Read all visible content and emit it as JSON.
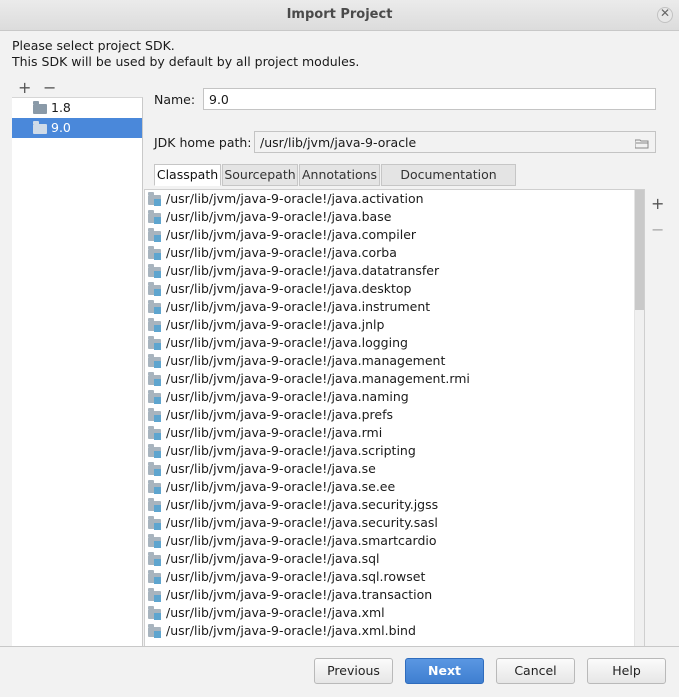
{
  "window": {
    "title": "Import Project",
    "close_glyph": "✕"
  },
  "intro": {
    "line1": "Please select project SDK.",
    "line2": "This SDK will be used by default by all project modules."
  },
  "sdk_toolbar": {
    "add": "+",
    "remove": "−"
  },
  "sdk_list": [
    {
      "label": "1.8",
      "selected": false,
      "icon": "folder-icon"
    },
    {
      "label": "9.0",
      "selected": true,
      "icon": "folder-icon"
    }
  ],
  "form": {
    "name_label": "Name:",
    "name_value": "9.0",
    "jdk_label": "JDK home path:",
    "jdk_value": "/usr/lib/jvm/java-9-oracle"
  },
  "tabs": [
    {
      "label": "Classpath",
      "active": true
    },
    {
      "label": "Sourcepath",
      "active": false
    },
    {
      "label": "Annotations",
      "active": false
    },
    {
      "label": "Documentation Paths",
      "active": false
    }
  ],
  "classpath": [
    "/usr/lib/jvm/java-9-oracle!/java.activation",
    "/usr/lib/jvm/java-9-oracle!/java.base",
    "/usr/lib/jvm/java-9-oracle!/java.compiler",
    "/usr/lib/jvm/java-9-oracle!/java.corba",
    "/usr/lib/jvm/java-9-oracle!/java.datatransfer",
    "/usr/lib/jvm/java-9-oracle!/java.desktop",
    "/usr/lib/jvm/java-9-oracle!/java.instrument",
    "/usr/lib/jvm/java-9-oracle!/java.jnlp",
    "/usr/lib/jvm/java-9-oracle!/java.logging",
    "/usr/lib/jvm/java-9-oracle!/java.management",
    "/usr/lib/jvm/java-9-oracle!/java.management.rmi",
    "/usr/lib/jvm/java-9-oracle!/java.naming",
    "/usr/lib/jvm/java-9-oracle!/java.prefs",
    "/usr/lib/jvm/java-9-oracle!/java.rmi",
    "/usr/lib/jvm/java-9-oracle!/java.scripting",
    "/usr/lib/jvm/java-9-oracle!/java.se",
    "/usr/lib/jvm/java-9-oracle!/java.se.ee",
    "/usr/lib/jvm/java-9-oracle!/java.security.jgss",
    "/usr/lib/jvm/java-9-oracle!/java.security.sasl",
    "/usr/lib/jvm/java-9-oracle!/java.smartcardio",
    "/usr/lib/jvm/java-9-oracle!/java.sql",
    "/usr/lib/jvm/java-9-oracle!/java.sql.rowset",
    "/usr/lib/jvm/java-9-oracle!/java.transaction",
    "/usr/lib/jvm/java-9-oracle!/java.xml",
    "/usr/lib/jvm/java-9-oracle!/java.xml.bind"
  ],
  "classpath_toolbar": {
    "add": "+",
    "remove": "−"
  },
  "buttons": {
    "previous": "Previous",
    "next": "Next",
    "cancel": "Cancel",
    "help": "Help"
  },
  "colors": {
    "selection": "#4a88da",
    "primary_button": "#4a88da",
    "jar_icon": "#5ea5cf"
  }
}
